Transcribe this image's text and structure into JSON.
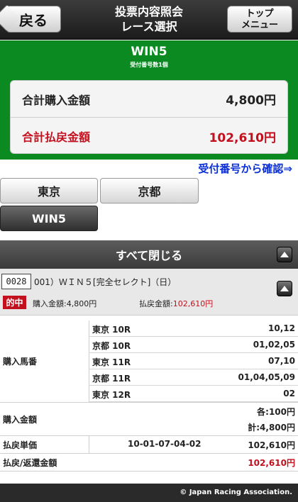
{
  "header": {
    "back_label": "戻る",
    "title_line1": "投票内容照会",
    "title_line2": "レース選択",
    "top_line1": "トップ",
    "top_line2": "メニュー"
  },
  "summary": {
    "title": "WIN5",
    "subtitle": "受付番号数1個",
    "total_purchase_label": "合計購入金額",
    "total_purchase_value": "4,800円",
    "total_payout_label": "合計払戻金額",
    "total_payout_value": "102,610円"
  },
  "confirm_link": "受付番号から確認⇒",
  "tabs": [
    {
      "label": "東京"
    },
    {
      "label": "京都"
    },
    {
      "label": "WIN5"
    }
  ],
  "collapse_all": "すべて閉じる",
  "ticket": {
    "number": "0028",
    "description": "001）ＷＩＮ５[完全セレクト]（日）",
    "hit_badge": "的中",
    "purchase_amount": "購入金額:4,800円",
    "payout_prefix": "払戻金額:",
    "payout_amount": "102,610円"
  },
  "detail": {
    "horses_label": "購入馬番",
    "races": [
      {
        "race": "東京 10R",
        "value": "10,12"
      },
      {
        "race": "京都 10R",
        "value": "01,02,05"
      },
      {
        "race": "東京 11R",
        "value": "07,10"
      },
      {
        "race": "京都 11R",
        "value": "01,04,05,09"
      },
      {
        "race": "東京 12R",
        "value": "02"
      }
    ],
    "purchase_label": "購入金額",
    "purchase_each": "各:100円",
    "purchase_total": "計:4,800円",
    "unit_label": "払戻単価",
    "unit_combo": "10-01-07-04-02",
    "unit_value": "102,610円",
    "refund_label": "払戻/返還金額",
    "refund_value": "102,610円"
  },
  "footer": "© Japan Racing Association.",
  "colors": {
    "green": "#0b8a22",
    "red": "#c2101e",
    "link": "#0b2fd6"
  }
}
